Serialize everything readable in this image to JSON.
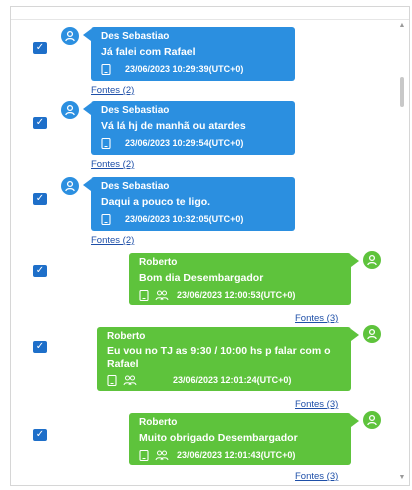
{
  "colors": {
    "blue_bubble": "#2b8fe0",
    "green_bubble": "#5ec33c",
    "checkbox": "#1e6fc9",
    "link": "#1e4fa8"
  },
  "messages": [
    {
      "sender": "Des Sebastiao",
      "text": "Já falei com Rafael",
      "timestamp": "23/06/2023 10:29:39(UTC+0)",
      "sources": "Fontes (2)",
      "direction": "incoming",
      "checked": true
    },
    {
      "sender": "Des Sebastiao",
      "text": "Vá lá hj de manhã ou atardes",
      "timestamp": "23/06/2023 10:29:54(UTC+0)",
      "sources": "Fontes (2)",
      "direction": "incoming",
      "checked": true
    },
    {
      "sender": "Des Sebastiao",
      "text": "Daqui a pouco te ligo.",
      "timestamp": "23/06/2023 10:32:05(UTC+0)",
      "sources": "Fontes (2)",
      "direction": "incoming",
      "checked": true
    },
    {
      "sender": "Roberto",
      "text": "Bom dia Desembargador",
      "timestamp": "23/06/2023 12:00:53(UTC+0)",
      "sources": "Fontes (3)",
      "direction": "outgoing",
      "checked": true
    },
    {
      "sender": "Roberto",
      "text": "Eu vou no TJ as 9:30 / 10:00 hs p falar com o Rafael",
      "timestamp": "23/06/2023 12:01:24(UTC+0)",
      "sources": "Fontes (3)",
      "direction": "outgoing",
      "checked": true
    },
    {
      "sender": "Roberto",
      "text": "Muito obrigado Desembargador",
      "timestamp": "23/06/2023 12:01:43(UTC+0)",
      "sources": "Fontes (3)",
      "direction": "outgoing",
      "checked": true
    }
  ],
  "icons": {
    "checkbox": "check-icon",
    "avatar": "user-avatar-icon",
    "device": "phone-icon",
    "participants": "group-icon"
  }
}
